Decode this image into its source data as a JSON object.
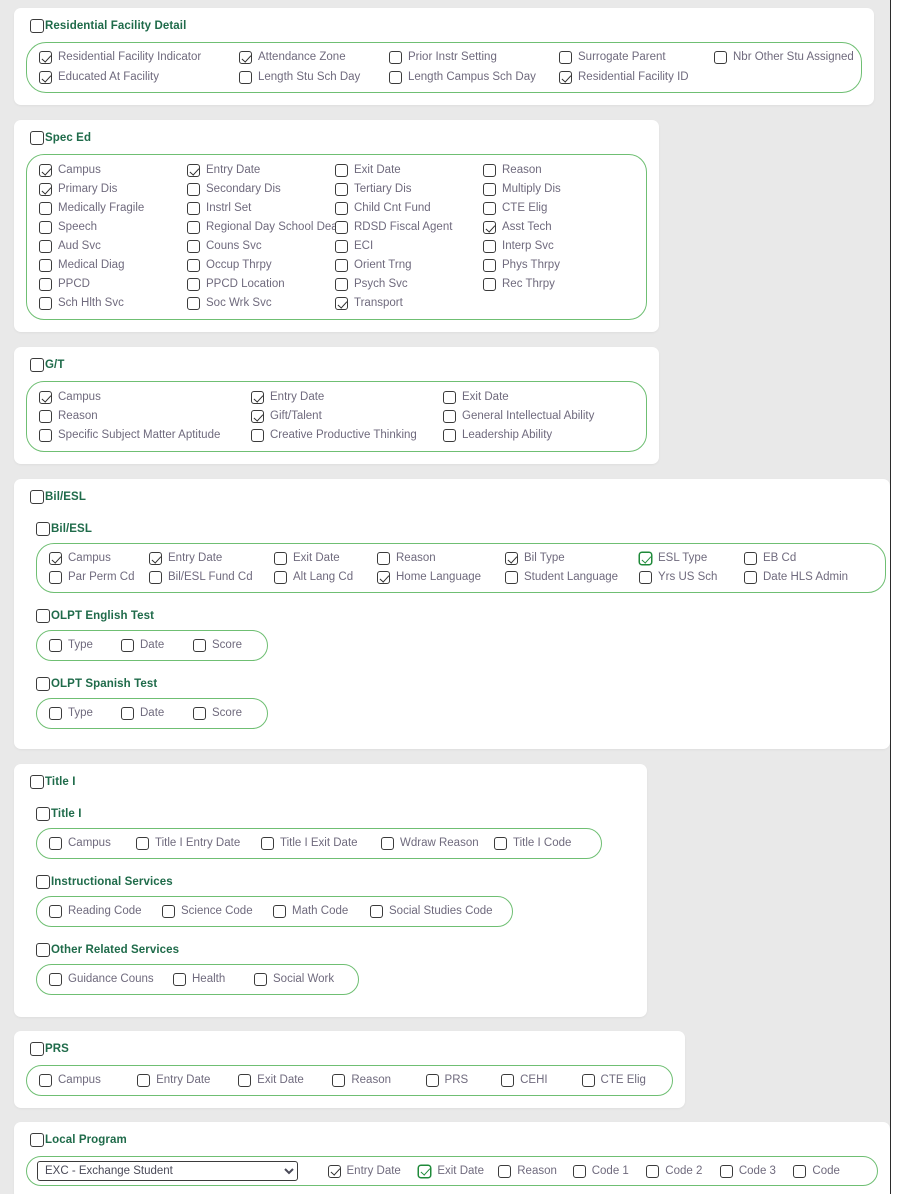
{
  "page": {
    "background": "#e9e9e9",
    "accent_green": "#6fbf73",
    "header_color": "#1f6b4a",
    "label_color": "#6f6a7d",
    "focus_color": "#1f8a3a"
  },
  "sections": {
    "residential_facility_detail": {
      "title": "Residential Facility Detail",
      "checked": false,
      "fields": [
        {
          "label": "Residential Facility Indicator",
          "checked": true,
          "focus": false
        },
        {
          "label": "Educated At Facility",
          "checked": true,
          "focus": false
        },
        {
          "label": "Attendance Zone",
          "checked": true,
          "focus": false
        },
        {
          "label": "Length Stu Sch Day",
          "checked": false,
          "focus": false
        },
        {
          "label": "Prior Instr Setting",
          "checked": false,
          "focus": false
        },
        {
          "label": "Length Campus Sch Day",
          "checked": false,
          "focus": false
        },
        {
          "label": "Surrogate Parent",
          "checked": false,
          "focus": false
        },
        {
          "label": "Residential Facility ID",
          "checked": true,
          "focus": false
        },
        {
          "label": "Nbr Other Stu Assigned",
          "checked": false,
          "focus": false
        }
      ]
    },
    "spec_ed": {
      "title": "Spec Ed",
      "checked": false,
      "fields": [
        {
          "label": "Campus",
          "checked": true,
          "focus": false
        },
        {
          "label": "Primary Dis",
          "checked": true,
          "focus": false
        },
        {
          "label": "Medically Fragile",
          "checked": false,
          "focus": false
        },
        {
          "label": "Speech",
          "checked": false,
          "focus": false
        },
        {
          "label": "Aud Svc",
          "checked": false,
          "focus": false
        },
        {
          "label": "Medical Diag",
          "checked": false,
          "focus": false
        },
        {
          "label": "PPCD",
          "checked": false,
          "focus": false
        },
        {
          "label": "Sch Hlth Svc",
          "checked": false,
          "focus": false
        },
        {
          "label": "Entry Date",
          "checked": true,
          "focus": false
        },
        {
          "label": "Secondary Dis",
          "checked": false,
          "focus": false
        },
        {
          "label": "Instrl Set",
          "checked": false,
          "focus": false
        },
        {
          "label": "Regional Day School Deaf",
          "checked": false,
          "focus": false
        },
        {
          "label": "Couns Svc",
          "checked": false,
          "focus": false
        },
        {
          "label": "Occup Thrpy",
          "checked": false,
          "focus": false
        },
        {
          "label": "PPCD Location",
          "checked": false,
          "focus": false
        },
        {
          "label": "Soc Wrk Svc",
          "checked": false,
          "focus": false
        },
        {
          "label": "Exit Date",
          "checked": false,
          "focus": false
        },
        {
          "label": "Tertiary Dis",
          "checked": false,
          "focus": false
        },
        {
          "label": "Child Cnt Fund",
          "checked": false,
          "focus": false
        },
        {
          "label": "RDSD Fiscal Agent",
          "checked": false,
          "focus": false
        },
        {
          "label": "ECI",
          "checked": false,
          "focus": false
        },
        {
          "label": "Orient Trng",
          "checked": false,
          "focus": false
        },
        {
          "label": "Psych Svc",
          "checked": false,
          "focus": false
        },
        {
          "label": "Transport",
          "checked": true,
          "focus": false
        },
        {
          "label": "Reason",
          "checked": false,
          "focus": false
        },
        {
          "label": "Multiply Dis",
          "checked": false,
          "focus": false
        },
        {
          "label": "CTE Elig",
          "checked": false,
          "focus": false
        },
        {
          "label": "Asst Tech",
          "checked": true,
          "focus": false
        },
        {
          "label": "Interp Svc",
          "checked": false,
          "focus": false
        },
        {
          "label": "Phys Thrpy",
          "checked": false,
          "focus": false
        },
        {
          "label": "Rec Thrpy",
          "checked": false,
          "focus": false
        }
      ]
    },
    "gt": {
      "title": "G/T",
      "checked": false,
      "fields": [
        {
          "label": "Campus",
          "checked": true,
          "focus": false
        },
        {
          "label": "Reason",
          "checked": false,
          "focus": false
        },
        {
          "label": "Specific Subject Matter Aptitude",
          "checked": false,
          "focus": false
        },
        {
          "label": "Entry Date",
          "checked": true,
          "focus": false
        },
        {
          "label": "Gift/Talent",
          "checked": true,
          "focus": false
        },
        {
          "label": "Creative Productive Thinking",
          "checked": false,
          "focus": false
        },
        {
          "label": "Exit Date",
          "checked": false,
          "focus": false
        },
        {
          "label": "General Intellectual Ability",
          "checked": false,
          "focus": false
        },
        {
          "label": "Leadership Ability",
          "checked": false,
          "focus": false
        }
      ]
    },
    "bil_esl_outer": {
      "title": "Bil/ESL",
      "checked": false,
      "bil_esl": {
        "title": "Bil/ESL",
        "checked": false,
        "fields": [
          {
            "label": "Campus",
            "checked": true,
            "focus": false
          },
          {
            "label": "Par Perm Cd",
            "checked": false,
            "focus": false
          },
          {
            "label": "Entry Date",
            "checked": true,
            "focus": false
          },
          {
            "label": "Bil/ESL Fund Cd",
            "checked": false,
            "focus": false
          },
          {
            "label": "Exit Date",
            "checked": false,
            "focus": false
          },
          {
            "label": "Alt Lang Cd",
            "checked": false,
            "focus": false
          },
          {
            "label": "Reason",
            "checked": false,
            "focus": false
          },
          {
            "label": "Home Language",
            "checked": true,
            "focus": false
          },
          {
            "label": "Bil Type",
            "checked": true,
            "focus": false
          },
          {
            "label": "Student Language",
            "checked": false,
            "focus": false
          },
          {
            "label": "ESL Type",
            "checked": true,
            "focus": true
          },
          {
            "label": "Yrs US Sch",
            "checked": false,
            "focus": false
          },
          {
            "label": "EB Cd",
            "checked": false,
            "focus": false
          },
          {
            "label": "Date HLS Admin",
            "checked": false,
            "focus": false
          }
        ]
      },
      "olpt_english": {
        "title": "OLPT English Test",
        "checked": false,
        "fields": [
          {
            "label": "Type",
            "checked": false,
            "focus": false
          },
          {
            "label": "Date",
            "checked": false,
            "focus": false
          },
          {
            "label": "Score",
            "checked": false,
            "focus": false
          }
        ]
      },
      "olpt_spanish": {
        "title": "OLPT Spanish Test",
        "checked": false,
        "fields": [
          {
            "label": "Type",
            "checked": false,
            "focus": false
          },
          {
            "label": "Date",
            "checked": false,
            "focus": false
          },
          {
            "label": "Score",
            "checked": false,
            "focus": false
          }
        ]
      }
    },
    "title_i_outer": {
      "title": "Title I",
      "checked": false,
      "title_i": {
        "title": "Title I",
        "checked": false,
        "fields": [
          {
            "label": "Campus",
            "checked": false,
            "focus": false
          },
          {
            "label": "Title I Entry Date",
            "checked": false,
            "focus": false
          },
          {
            "label": "Title I Exit Date",
            "checked": false,
            "focus": false
          },
          {
            "label": "Wdraw Reason",
            "checked": false,
            "focus": false
          },
          {
            "label": "Title I Code",
            "checked": false,
            "focus": false
          }
        ]
      },
      "instructional_services": {
        "title": "Instructional Services",
        "checked": false,
        "fields": [
          {
            "label": "Reading Code",
            "checked": false,
            "focus": false
          },
          {
            "label": "Science Code",
            "checked": false,
            "focus": false
          },
          {
            "label": "Math Code",
            "checked": false,
            "focus": false
          },
          {
            "label": "Social Studies Code",
            "checked": false,
            "focus": false
          }
        ]
      },
      "other_related_services": {
        "title": "Other Related Services",
        "checked": false,
        "fields": [
          {
            "label": "Guidance Couns",
            "checked": false,
            "focus": false
          },
          {
            "label": "Health",
            "checked": false,
            "focus": false
          },
          {
            "label": "Social Work",
            "checked": false,
            "focus": false
          }
        ]
      }
    },
    "prs": {
      "title": "PRS",
      "checked": false,
      "fields": [
        {
          "label": "Campus",
          "checked": false,
          "focus": false
        },
        {
          "label": "Entry Date",
          "checked": false,
          "focus": false
        },
        {
          "label": "Exit Date",
          "checked": false,
          "focus": false
        },
        {
          "label": "Reason",
          "checked": false,
          "focus": false
        },
        {
          "label": "PRS",
          "checked": false,
          "focus": false
        },
        {
          "label": "CEHI",
          "checked": false,
          "focus": false
        },
        {
          "label": "CTE Elig",
          "checked": false,
          "focus": false
        }
      ]
    },
    "local_program": {
      "title": "Local Program",
      "checked": false,
      "select": {
        "selected": "EXC - Exchange Student",
        "options": [
          "EXC - Exchange Student"
        ]
      },
      "fields": [
        {
          "label": "Entry Date",
          "checked": true,
          "focus": false
        },
        {
          "label": "Exit Date",
          "checked": true,
          "focus": true
        },
        {
          "label": "Reason",
          "checked": false,
          "focus": false
        },
        {
          "label": "Code 1",
          "checked": false,
          "focus": false
        },
        {
          "label": "Code 2",
          "checked": false,
          "focus": false
        },
        {
          "label": "Code 3",
          "checked": false,
          "focus": false
        },
        {
          "label": "Code",
          "checked": false,
          "focus": false
        }
      ]
    }
  }
}
